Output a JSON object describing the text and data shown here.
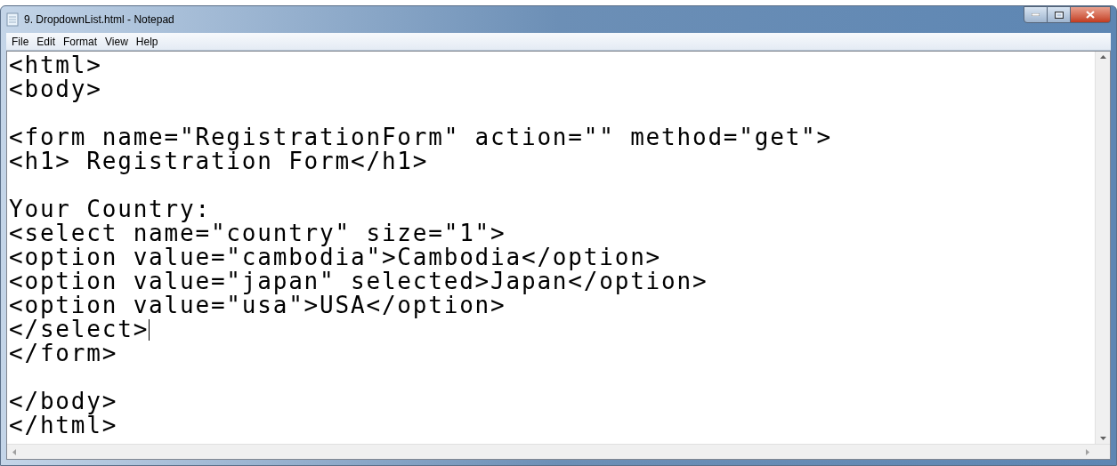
{
  "window": {
    "title": "9. DropdownList.html - Notepad"
  },
  "menu": [
    "File",
    "Edit",
    "Format",
    "View",
    "Help"
  ],
  "editor": {
    "lines": [
      {
        "kind": "code",
        "text": "<html>",
        "caret": false
      },
      {
        "kind": "code",
        "text": "<body>",
        "caret": false
      },
      {
        "kind": "blank"
      },
      {
        "kind": "code",
        "text": "<form name=\"RegistrationForm\" action=\"\" method=\"get\">",
        "caret": false
      },
      {
        "kind": "code",
        "text": "<h1> Registration Form</h1>",
        "caret": false
      },
      {
        "kind": "blank"
      },
      {
        "kind": "code",
        "text": "Your Country:",
        "caret": false
      },
      {
        "kind": "code",
        "text": "<select name=\"country\" size=\"1\">",
        "caret": false
      },
      {
        "kind": "code",
        "text": "<option value=\"cambodia\">Cambodia</option>",
        "caret": false
      },
      {
        "kind": "code",
        "text": "<option value=\"japan\" selected>Japan</option>",
        "caret": false
      },
      {
        "kind": "code",
        "text": "<option value=\"usa\">USA</option>",
        "caret": false
      },
      {
        "kind": "code",
        "text": "</select>",
        "caret": true
      },
      {
        "kind": "code",
        "text": "</form>",
        "caret": false
      },
      {
        "kind": "blank"
      },
      {
        "kind": "code",
        "text": "</body>",
        "caret": false
      },
      {
        "kind": "code",
        "text": "</html>",
        "caret": false
      }
    ]
  }
}
